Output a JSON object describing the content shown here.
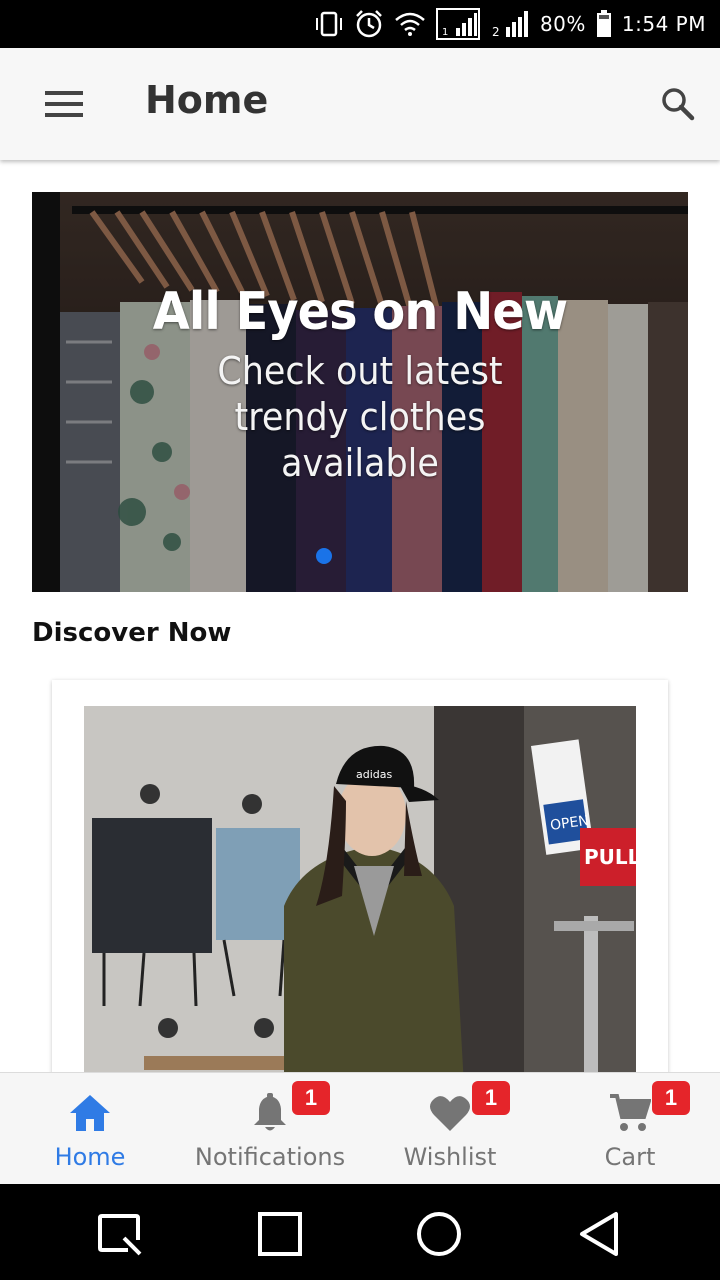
{
  "status_bar": {
    "battery_percent": "80%",
    "time": "1:54 PM",
    "icons": [
      "vibrate-icon",
      "alarm-icon",
      "wifi-icon",
      "signal-sim1-icon",
      "signal-sim2-icon",
      "battery-icon"
    ]
  },
  "app_bar": {
    "title": "Home",
    "menu_icon": "hamburger-menu-icon",
    "search_icon": "search-icon"
  },
  "banner": {
    "title": "All Eyes on New",
    "subtitle_lines": [
      "Check out latest",
      "trendy clothes",
      "available"
    ],
    "active_dot_color": "#1a73e8"
  },
  "discover": {
    "title": "Discover Now"
  },
  "bottom_nav": {
    "active_color": "#2f7be5",
    "badge_color": "#e5252a",
    "items": [
      {
        "label": "Home",
        "icon": "home-icon",
        "badge": ""
      },
      {
        "label": "Notifications",
        "icon": "bell-icon",
        "badge": "1"
      },
      {
        "label": "Wishlist",
        "icon": "heart-icon",
        "badge": "1"
      },
      {
        "label": "Cart",
        "icon": "cart-icon",
        "badge": "1"
      }
    ]
  },
  "system_nav": {
    "icons": [
      "screenshot-icon",
      "recents-icon",
      "home-circle-icon",
      "back-icon"
    ]
  }
}
